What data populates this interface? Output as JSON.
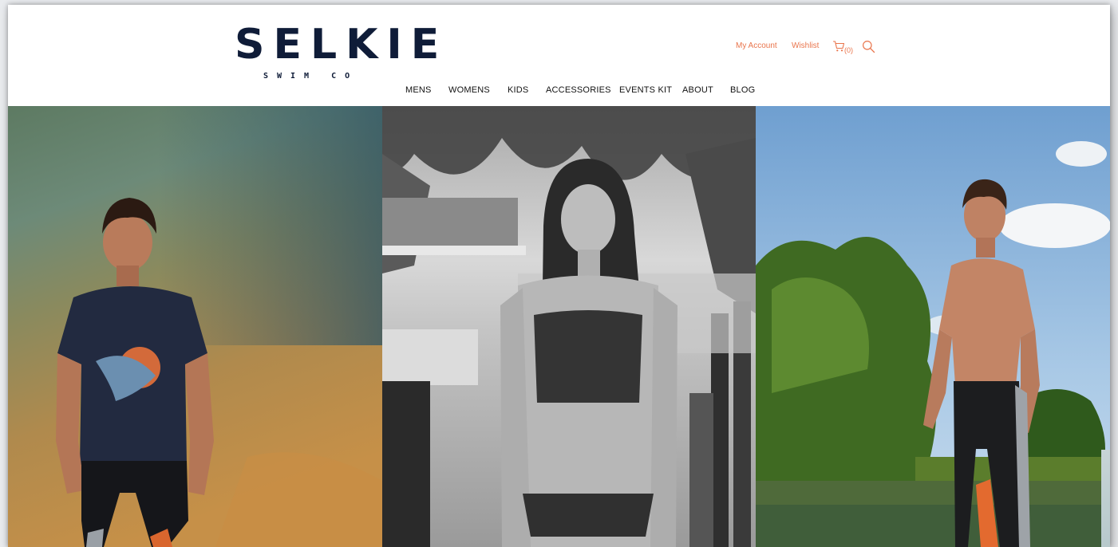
{
  "brand": {
    "name": "SELKIE",
    "tagline": "SWIM CO"
  },
  "utility": {
    "account": "My Account",
    "wishlist": "Wishlist",
    "cart_count": "(0)"
  },
  "nav": [
    {
      "label": "MENS"
    },
    {
      "label": "WOMENS"
    },
    {
      "label": "KIDS"
    },
    {
      "label": "ACCESSORIES"
    },
    {
      "label": "EVENTS KIT"
    },
    {
      "label": "ABOUT"
    },
    {
      "label": "BLOG"
    }
  ],
  "colors": {
    "brand_navy": "#0f1c38",
    "accent": "#e9754c",
    "nav_text": "#111111"
  },
  "icons": [
    "cart-icon",
    "search-icon"
  ],
  "hero": {
    "panels": [
      {
        "alt": "Man in navy whale-print t-shirt and wetsuit shorts standing in a lake"
      },
      {
        "alt": "Black and white photo of woman in sports bikini by a river under willow branches"
      },
      {
        "alt": "Man in black and orange swim leggings standing by a lake with trees and sky"
      }
    ]
  }
}
